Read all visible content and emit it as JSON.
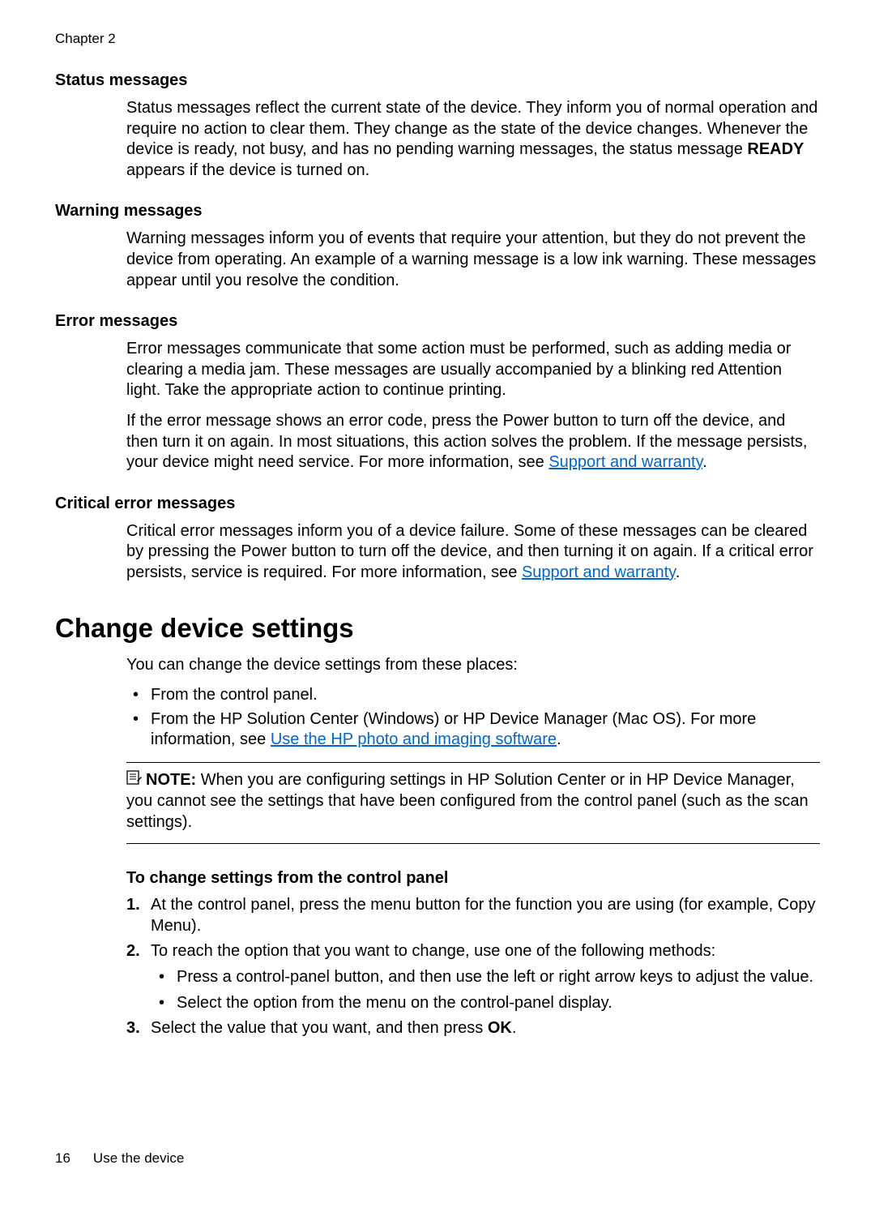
{
  "chapter": "Chapter 2",
  "sections": {
    "status": {
      "heading": "Status messages",
      "body": "Status messages reflect the current state of the device. They inform you of normal operation and require no action to clear them. They change as the state of the device changes. Whenever the device is ready, not busy, and has no pending warning messages, the status message ",
      "ready": "READY",
      "body2": " appears if the device is turned on."
    },
    "warning": {
      "heading": "Warning messages",
      "body": "Warning messages inform you of events that require your attention, but they do not prevent the device from operating. An example of a warning message is a low ink warning. These messages appear until you resolve the condition."
    },
    "error": {
      "heading": "Error messages",
      "body1": "Error messages communicate that some action must be performed, such as adding media or clearing a media jam. These messages are usually accompanied by a blinking red Attention light. Take the appropriate action to continue printing.",
      "body2a": "If the error message shows an error code, press the Power button to turn off the device, and then turn it on again. In most situations, this action solves the problem. If the message persists, your device might need service. For more information, see ",
      "link": "Support and warranty",
      "body2b": "."
    },
    "critical": {
      "heading": "Critical error messages",
      "body_a": "Critical error messages inform you of a device failure. Some of these messages can be cleared by pressing the Power button to turn off the device, and then turning it on again. If a critical error persists, service is required. For more information, see ",
      "link": "Support and warranty",
      "body_b": "."
    }
  },
  "change_settings": {
    "heading": "Change device settings",
    "intro": "You can change the device settings from these places:",
    "bullet1": "From the control panel.",
    "bullet2a": "From the HP Solution Center (Windows) or HP Device Manager (Mac OS). For more information, see ",
    "bullet2_link": "Use the HP photo and imaging software",
    "bullet2b": ".",
    "note_label": "NOTE:",
    "note_body": " When you are configuring settings in HP Solution Center or in HP Device Manager, you cannot see the settings that have been configured from the control panel (such as the scan settings).",
    "sub_heading": "To change settings from the control panel",
    "step1": "At the control panel, press the menu button for the function you are using (for example, Copy Menu).",
    "step2": "To reach the option that you want to change, use one of the following methods:",
    "step2_sub1": "Press a control-panel button, and then use the left or right arrow keys to adjust the value.",
    "step2_sub2": "Select the option from the menu on the control-panel display.",
    "step3a": "Select the value that you want, and then press ",
    "step3_ok": "OK",
    "step3b": "."
  },
  "footer": {
    "page_number": "16",
    "title": "Use the device"
  }
}
